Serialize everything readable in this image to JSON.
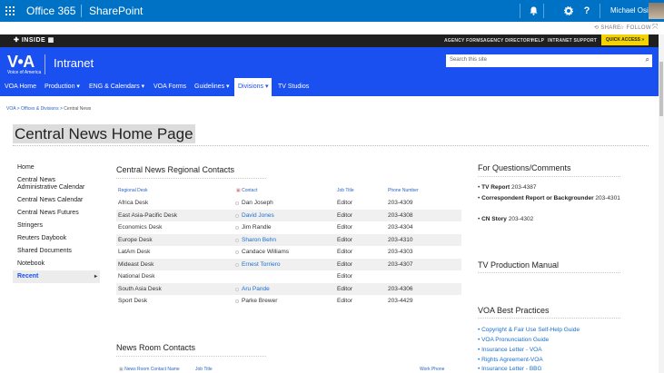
{
  "suitebar": {
    "brand": "Office 365",
    "app": "SharePoint",
    "user": "Michael Osicki",
    "icons": [
      "app-launcher-icon",
      "notification-bell-icon",
      "settings-gear-icon",
      "help-icon"
    ]
  },
  "actions": {
    "share": "SHARE",
    "follow": "FOLLOW"
  },
  "topbar": {
    "inside": "INSIDE",
    "links": [
      "AGENCY FORMS",
      "AGENCY DIRECTORY",
      "HELP",
      "INTRANET SUPPORT"
    ],
    "quick_access": "QUICK ACCESS »"
  },
  "header": {
    "logo": "V•A",
    "logo_sub": "Voice of America",
    "site_title": "Intranet",
    "search_placeholder": "Search this site"
  },
  "nav": {
    "items": [
      {
        "label": "VOA Home"
      },
      {
        "label": "Production ▾"
      },
      {
        "label": "ENG & Calendars ▾"
      },
      {
        "label": "VOA Forms"
      },
      {
        "label": "Guidelines ▾"
      },
      {
        "label": "Divisions ▾"
      },
      {
        "label": "TV Studios"
      }
    ]
  },
  "breadcrumb": {
    "part1": "VOA",
    "sep": " > ",
    "part2": "Offices & Divisions",
    "part3": "Central News"
  },
  "page_title": "Central News Home Page",
  "leftnav": {
    "items": [
      "Home",
      "Central News Administrative Calendar",
      "Central News Calendar",
      "Central News Futures",
      "Stringers",
      "Reuters Daybook",
      "Shared Documents",
      "Notebook"
    ],
    "recent": "Recent"
  },
  "regional": {
    "title": "Central News Regional Contacts",
    "headers": [
      "Regional Desk",
      "Contact",
      "Job Title",
      "Phone Number"
    ],
    "rows": [
      {
        "desk": "Africa Desk",
        "contact": "Dan Joseph",
        "title": "Editor",
        "phone": "203-4309"
      },
      {
        "desk": "East Asia-Pacific Desk",
        "contact": "David Jones",
        "title": "Editor",
        "phone": "203-4308"
      },
      {
        "desk": "Economics Desk",
        "contact": "Jim Randle",
        "title": "Editor",
        "phone": "203-4304"
      },
      {
        "desk": "Europe Desk",
        "contact": "Sharon Behn",
        "title": "Editor",
        "phone": "203-4310"
      },
      {
        "desk": "LatAm Desk",
        "contact": "Candace Williams",
        "title": "Editor",
        "phone": "203-4303"
      },
      {
        "desk": "Mideast Desk",
        "contact": "Ernest Torriero",
        "title": "Editor",
        "phone": "203-4307"
      },
      {
        "desk": "National Desk",
        "contact": "",
        "title": "Editor",
        "phone": ""
      },
      {
        "desk": "South Asia Desk",
        "contact": "Aru Pande",
        "title": "Editor",
        "phone": "203-4306"
      },
      {
        "desk": "Sport Desk",
        "contact": "Parke Brewer",
        "title": "Editor",
        "phone": "203-4429"
      }
    ]
  },
  "newsroom": {
    "title": "News Room Contacts",
    "headers": [
      "News Room Contact Name",
      "Job Title",
      "Work Phone"
    ]
  },
  "questions": {
    "title": "For Questions/Comments",
    "items": [
      {
        "bold": "TV Report",
        "text": " 203-4387"
      },
      {
        "bold": "Correspondent Report or Backgrounder",
        "text": " 203-4301"
      },
      {
        "bold": "CN Story",
        "text": " 203-4302"
      }
    ]
  },
  "tv_manual": {
    "title": "TV Production Manual"
  },
  "best_practices": {
    "title": "VOA Best Practices",
    "items": [
      "Copyright & Fair Use Self-Help Guide",
      "VOA Pronunciation Guide",
      "Insurance Letter - VOA",
      "Rights Agreement-VOA",
      "Insurance Letter - BBG"
    ]
  }
}
